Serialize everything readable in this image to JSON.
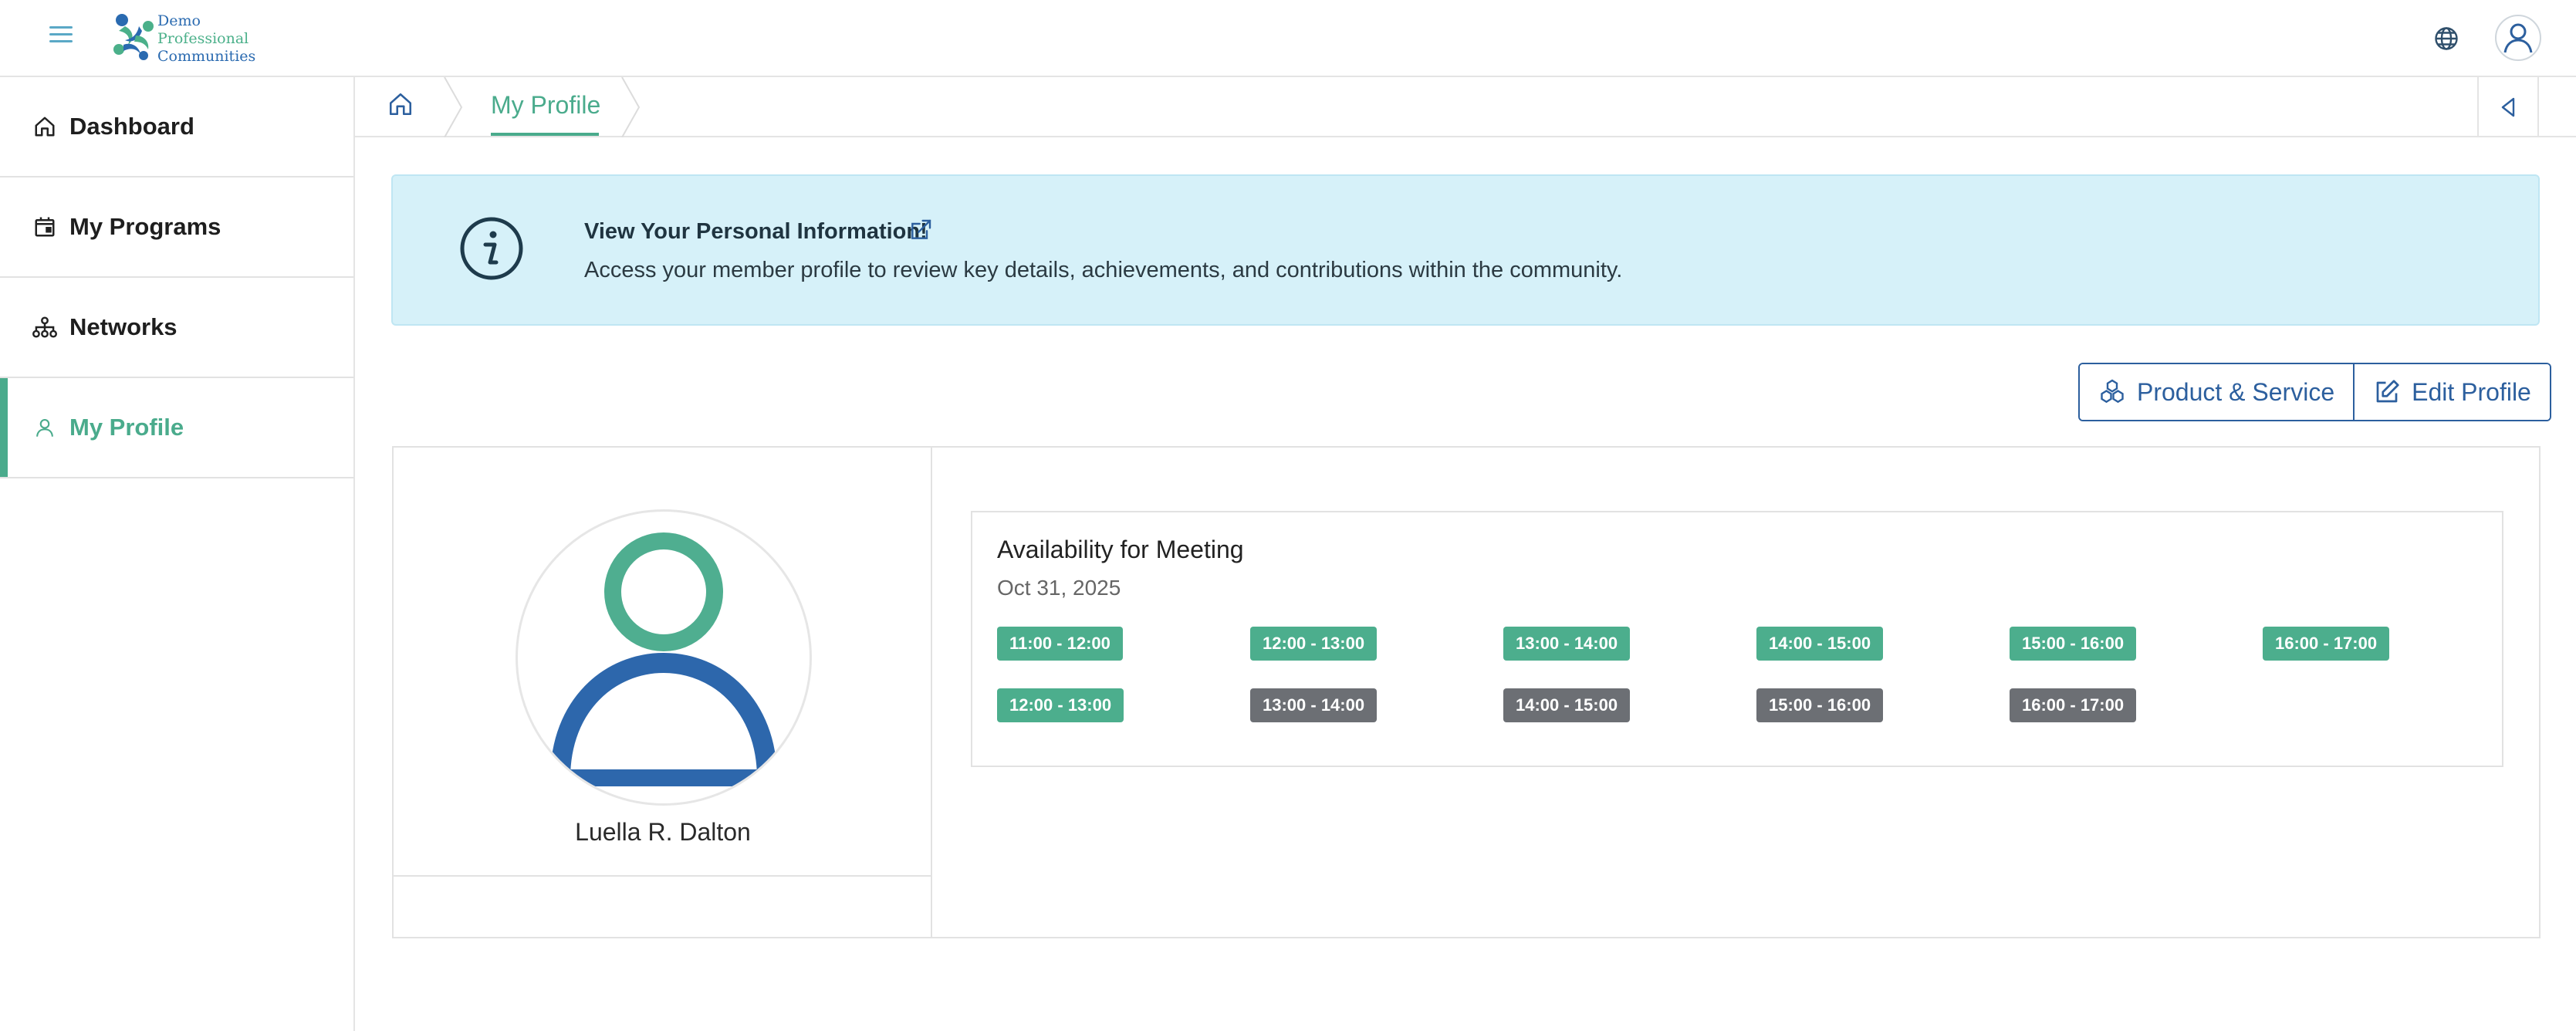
{
  "header": {
    "logo_lines": [
      "Demo",
      "Professional",
      "Communities"
    ]
  },
  "sidebar": {
    "items": [
      {
        "label": "Dashboard",
        "icon": "home-icon"
      },
      {
        "label": "My Programs",
        "icon": "calendar-icon"
      },
      {
        "label": "Networks",
        "icon": "network-icon"
      },
      {
        "label": "My Profile",
        "icon": "user-icon",
        "active": true
      }
    ]
  },
  "breadcrumb": {
    "home_icon": "home-icon",
    "current": "My Profile"
  },
  "alert": {
    "title": "View Your Personal Information!",
    "body": "Access your member profile to review key details, achievements, and contributions within the community."
  },
  "actions": {
    "product_service": "Product & Service",
    "edit_profile": "Edit Profile"
  },
  "profile": {
    "name": "Luella R. Dalton"
  },
  "availability": {
    "title": "Availability for Meeting",
    "date": "Oct 31, 2025",
    "rows": [
      [
        {
          "label": "11:00 - 12:00",
          "status": "available"
        },
        {
          "label": "12:00 - 13:00",
          "status": "available"
        },
        {
          "label": "13:00 - 14:00",
          "status": "available"
        },
        {
          "label": "14:00 - 15:00",
          "status": "available"
        },
        {
          "label": "15:00 - 16:00",
          "status": "available"
        },
        {
          "label": "16:00 - 17:00",
          "status": "available"
        }
      ],
      [
        {
          "label": "12:00 - 13:00",
          "status": "available"
        },
        {
          "label": "13:00 - 14:00",
          "status": "unavailable"
        },
        {
          "label": "14:00 - 15:00",
          "status": "unavailable"
        },
        {
          "label": "15:00 - 16:00",
          "status": "unavailable"
        },
        {
          "label": "16:00 - 17:00",
          "status": "unavailable"
        }
      ]
    ]
  },
  "colors": {
    "accent": "#4aab8c",
    "primary": "#2c5f9e",
    "slot_available": "#4cae8d",
    "slot_unavailable": "#6c6f74",
    "alert_bg": "#d6f1f9"
  }
}
